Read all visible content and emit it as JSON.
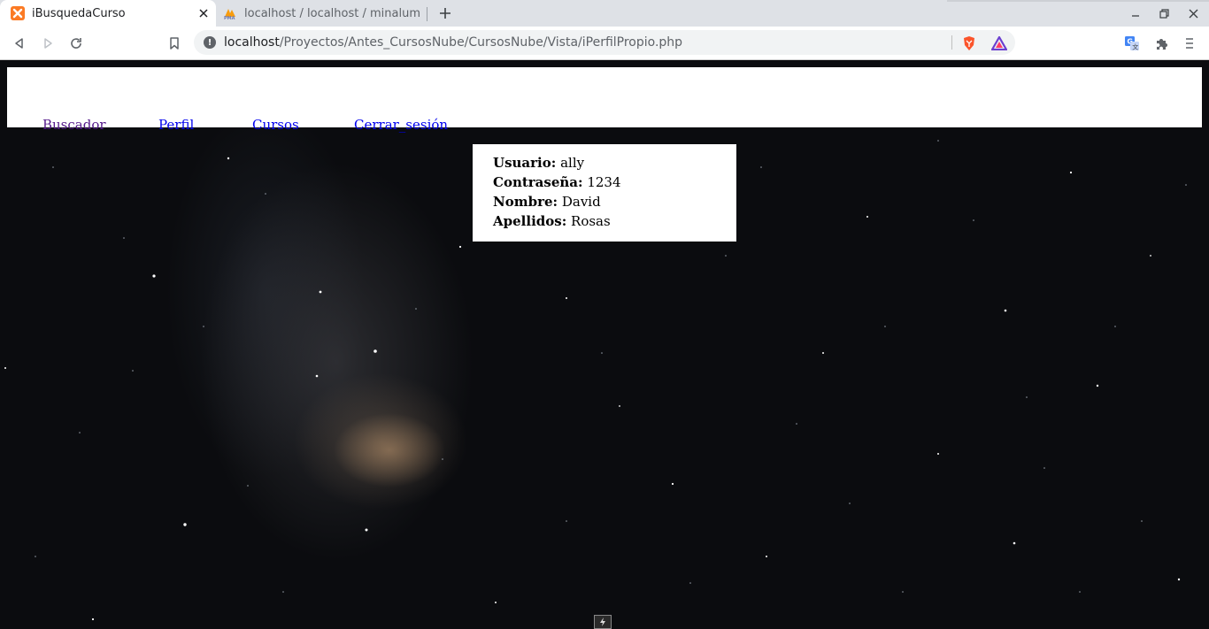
{
  "browser": {
    "tabs": [
      {
        "title": "iBusquedaCurso",
        "active": true,
        "favicon": "xampp-icon"
      },
      {
        "title": "localhost / localhost / minalum",
        "active": false,
        "favicon": "phpmyadmin-icon"
      }
    ],
    "address": {
      "host": "localhost",
      "path": "/Proyectos/Antes_CursosNube/CursosNube/Vista/iPerfilPropio.php"
    }
  },
  "nav": {
    "links": [
      {
        "label": "Buscador",
        "visited": true
      },
      {
        "label": "Perfil",
        "visited": false
      },
      {
        "label": "Cursos",
        "visited": false
      },
      {
        "label": "Cerrar_sesión",
        "visited": false
      }
    ]
  },
  "profile": {
    "fields": [
      {
        "label": "Usuario:",
        "value": "ally"
      },
      {
        "label": "Contraseña:",
        "value": "1234"
      },
      {
        "label": "Nombre:",
        "value": "David"
      },
      {
        "label": "Apellidos:",
        "value": "Rosas"
      }
    ]
  },
  "colors": {
    "visited_link": "#551a8b",
    "unvisited_link": "#0000ee",
    "tab_strip": "#dee1e6",
    "xampp_orange": "#fb7a24"
  }
}
